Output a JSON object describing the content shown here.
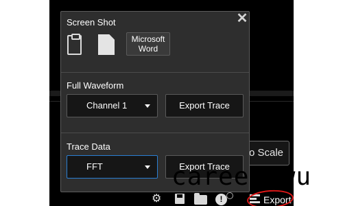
{
  "screenshot": {
    "title": "Screen Shot",
    "clipboard_icon": "clipboard-icon",
    "document_icon": "document-icon",
    "word_button_line1": "Microsoft",
    "word_button_line2": "Word"
  },
  "close_symbol": "✕",
  "full_waveform": {
    "title": "Full Waveform",
    "channel_select": "Channel 1",
    "export_label": "Export Trace"
  },
  "trace_data": {
    "title": "Trace Data",
    "format_select": "FFT",
    "export_label": "Export Trace"
  },
  "background": {
    "auto_scale_label": "uto Scale"
  },
  "toolbar": {
    "settings_icon": "gear-icon",
    "save_icon": "save-icon",
    "open_icon": "folder-icon",
    "info_icon": "info-icon",
    "info_glyph": "!",
    "export_icon": "export-icon",
    "export_label": "Export"
  },
  "watermark": {
    "text": "career-wu"
  },
  "colors": {
    "panel_bg": "#2e2e2e",
    "active_border": "#2a7fd4",
    "annotation": "#e01818"
  }
}
